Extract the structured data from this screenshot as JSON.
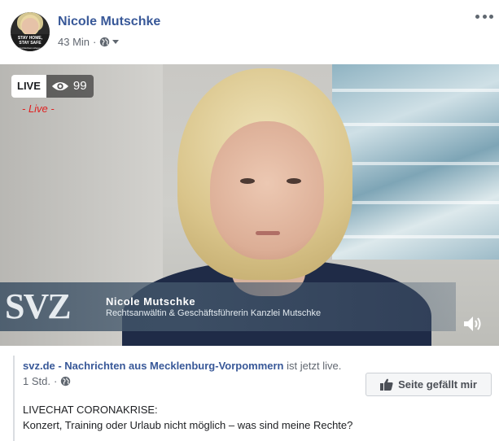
{
  "post": {
    "author": "Nicole Mutschke",
    "time": "43 Min",
    "separator": "·",
    "avatar_text": [
      "STAY HOME,",
      "STAY SAFE",
      "#wirbleibenzuhause"
    ]
  },
  "video": {
    "live_label": "LIVE",
    "viewer_count": "99",
    "live_subtitle": "- Live -",
    "lower_third_logo": "SVZ",
    "lower_third_name": "Nicole Mutschke",
    "lower_third_title": "Rechtsanwältin & Geschäftsführerin Kanzlei Mutschke"
  },
  "shared": {
    "page_name": "svz.de - Nachrichten aus Mecklenburg-Vorpommern",
    "status_text": "ist jetzt live.",
    "time": "1 Std.",
    "separator": "·",
    "like_button_label": "Seite gefällt mir",
    "description_line1": "LIVECHAT CORONAKRISE:",
    "description_line2": "Konzert, Training oder Urlaub nicht möglich – was sind meine Rechte?"
  },
  "colors": {
    "link": "#385898",
    "meta": "#616770",
    "live_red": "#e02020"
  },
  "icons": [
    "more-options-icon",
    "globe-icon",
    "caret-down-icon",
    "eye-icon",
    "volume-icon",
    "thumbs-up-icon"
  ]
}
